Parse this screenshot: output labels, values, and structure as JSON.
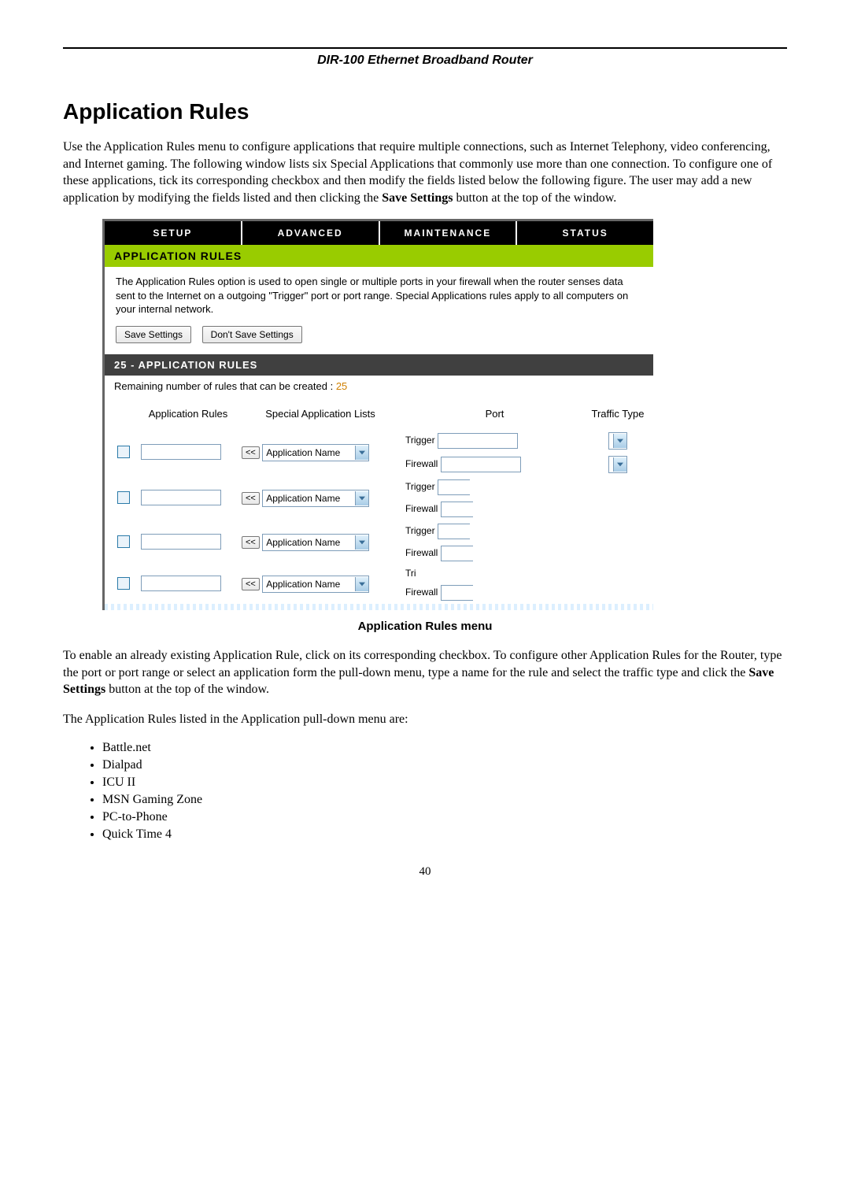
{
  "header": {
    "product": "DIR-100 Ethernet Broadband Router"
  },
  "title": "Application Rules",
  "intro": "Use the Application Rules menu to configure applications that require multiple connections, such as Internet Telephony, video conferencing, and Internet gaming. The following window lists six Special Applications that commonly use more than one connection. To configure one of these applications, tick its corresponding checkbox and then modify the fields listed below the following figure. The user may add a new application by modifying the fields listed and then clicking the ",
  "intro_bold": "Save Settings",
  "intro_tail": " button at the top of the window.",
  "ui": {
    "tabs": [
      "SETUP",
      "ADVANCED",
      "MAINTENANCE",
      "STATUS"
    ],
    "green_title": "APPLICATION RULES",
    "desc": "The Application Rules option is used to open single or multiple ports in your firewall when the router senses data sent to the Internet on a outgoing \"Trigger\" port or port range. Special Applications rules apply to all computers on your internal network.",
    "save": "Save Settings",
    "dont": "Don't Save Settings",
    "dark_title": "25 - APPLICATION RULES",
    "remaining_label": "Remaining number of rules that can be created : ",
    "remaining_value": "25",
    "cols": {
      "c1": "Application Rules",
      "c2": "Special Application Lists",
      "c3": "Port",
      "c4": "Traffic Type"
    },
    "copy_btn": "<<",
    "app_name": "Application Name",
    "trigger": "Trigger",
    "firewall": "Firewall",
    "trigger_cut": "Tri"
  },
  "caption": "Application Rules menu",
  "after1a": "To enable an already existing Application Rule, click on its corresponding checkbox. To configure other Application Rules for the Router, type the port or port range or select an application form the pull-down menu, type a name for the rule and select the traffic type and click the ",
  "after1b": "Save Settings",
  "after1c": " button at the top of the window.",
  "after2": "The Application Rules listed in the Application pull-down menu are:",
  "apps": [
    "Battle.net",
    "Dialpad",
    "ICU II",
    "MSN Gaming Zone",
    "PC-to-Phone",
    "Quick Time 4"
  ],
  "page_number": "40"
}
